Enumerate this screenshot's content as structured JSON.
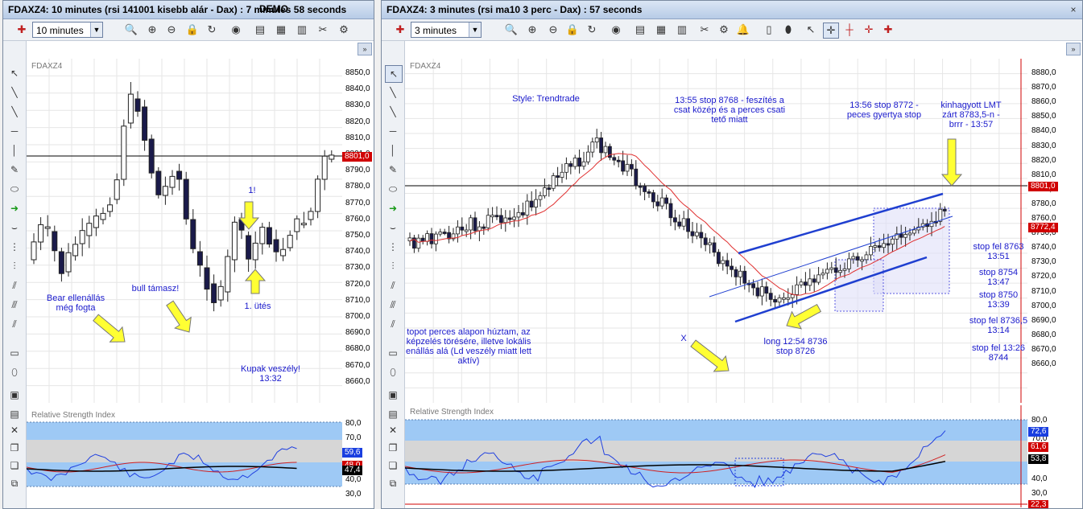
{
  "left_window": {
    "title": "FDAXZ4: 10 minutes (rsi 141001 kisebb alár - Dax) : 7 minutes 58 seconds",
    "timeframe": "10 minutes",
    "symbol": "FDAXZ4",
    "price_ticks": [
      "8850,0",
      "8840,0",
      "8830,0",
      "8820,0",
      "8810,0",
      "8801,0",
      "8790,0",
      "8780,0",
      "8770,0",
      "8760,0",
      "8750,0",
      "8740,0",
      "8730,0",
      "8720,0",
      "8710,0",
      "8700,0",
      "8690,0",
      "8680,0",
      "8670,0",
      "8660,0"
    ],
    "current_price": "8801,0",
    "rsi_title": "Relative Strength Index",
    "rsi_ticks": [
      "80,0",
      "70,0",
      "40,0",
      "30,0"
    ],
    "rsi_badges": [
      "59,6",
      "48,0",
      "47,4"
    ],
    "annotations": [
      "Bear ellenállás még fogta",
      "bull támasz!",
      "1!",
      "1. ütés",
      "Kupak veszély! 13:32"
    ]
  },
  "right_window": {
    "title": "FDAXZ4: 3 minutes (rsi ma10 3 perc - Dax) : 57 seconds",
    "timeframe": "3 minutes",
    "symbol": "FDAXZ4",
    "price_ticks": [
      "8880,0",
      "8870,0",
      "8860,0",
      "8850,0",
      "8840,0",
      "8830,0",
      "8820,0",
      "8810,0",
      "8790,0",
      "8780,0",
      "8760,0",
      "8750,0",
      "8740,0",
      "8730,0",
      "8720,0",
      "8710,0",
      "8700,0",
      "8690,0",
      "8680,0",
      "8670,0",
      "8660,0"
    ],
    "current_price": "8801,0",
    "ma_price": "8772,4",
    "rsi_title": "Relative Strength Index",
    "rsi_ticks": [
      "80,0",
      "70,0",
      "40,0",
      "30,0"
    ],
    "rsi_badges": [
      "72,6",
      "61,6",
      "53,8",
      "22,3"
    ],
    "annotations": [
      "Style: Trendtrade",
      "13:55 stop 8768 - feszítés a csat közép és a perces csati tető miatt",
      "13:56 stop 8772 - peces gyertya stop",
      "kinhagyott LMT zárt 8783,5-n - brrr - 13:57",
      "topot perces alapon húztam, az képzelés törésére, illetve lokális enállás alá (Ld veszély miatt lett aktív)",
      "X",
      "long 12:54 8736 stop 8726",
      "stop fel 8763 13:51",
      "stop 8754 13:47",
      "stop 8750 13:39",
      "stop fel 8736,5 13:14",
      "stop fel 13:26 8744"
    ]
  },
  "app_title_suffix": "DEMO",
  "colors": {
    "bull": "#ffffff",
    "bear": "#1a1a4a",
    "accent": "#1f3fd0",
    "price_badge": "#d00000",
    "rsi_band": "#9ec9f5"
  }
}
